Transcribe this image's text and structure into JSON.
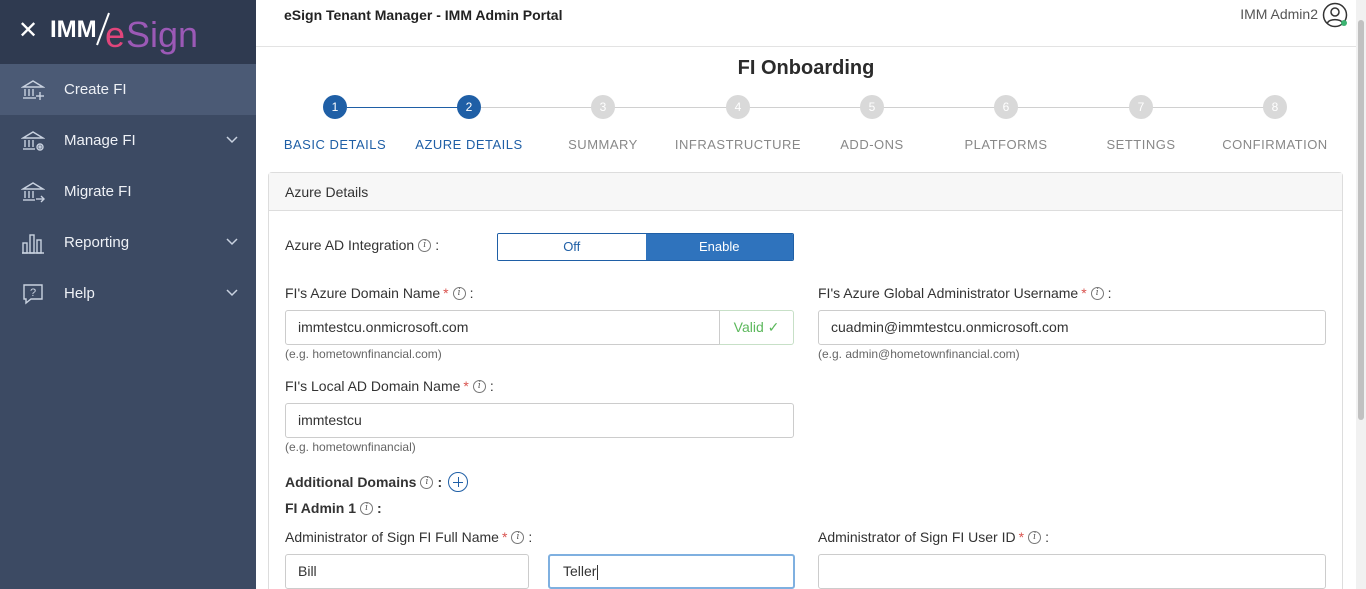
{
  "sidebar": {
    "logo_text": "IMM eSign",
    "items": [
      {
        "label": "Create FI",
        "icon": "bank-add-icon",
        "active": true,
        "expandable": false
      },
      {
        "label": "Manage FI",
        "icon": "bank-gear-icon",
        "active": false,
        "expandable": true
      },
      {
        "label": "Migrate FI",
        "icon": "bank-arrow-icon",
        "active": false,
        "expandable": false
      },
      {
        "label": "Reporting",
        "icon": "bar-chart-icon",
        "active": false,
        "expandable": true
      },
      {
        "label": "Help",
        "icon": "help-icon",
        "active": false,
        "expandable": true
      }
    ]
  },
  "header": {
    "title": "eSign Tenant Manager - IMM Admin Portal",
    "user": "IMM Admin2"
  },
  "page": {
    "title": "FI Onboarding"
  },
  "stepper": {
    "current_step": 2,
    "steps": [
      {
        "num": "1",
        "label": "BASIC DETAILS"
      },
      {
        "num": "2",
        "label": "AZURE DETAILS"
      },
      {
        "num": "3",
        "label": "SUMMARY"
      },
      {
        "num": "4",
        "label": "INFRASTRUCTURE"
      },
      {
        "num": "5",
        "label": "ADD-ONS"
      },
      {
        "num": "6",
        "label": "PLATFORMS"
      },
      {
        "num": "7",
        "label": "SETTINGS"
      },
      {
        "num": "8",
        "label": "CONFIRMATION"
      }
    ]
  },
  "form": {
    "section_title": "Azure Details",
    "azure_ad": {
      "label": "Azure AD Integration",
      "off": "Off",
      "on": "Enable",
      "selected": "Enable"
    },
    "domain_name": {
      "label": "FI's Azure Domain Name",
      "value": "immtestcu.onmicrosoft.com",
      "valid_text": "Valid",
      "hint": "(e.g. hometownfinancial.com)"
    },
    "global_admin": {
      "label": "FI's Azure Global Administrator Username",
      "value": "cuadmin@immtestcu.onmicrosoft.com",
      "hint": "(e.g. admin@hometownfinancial.com)"
    },
    "local_ad": {
      "label": "FI's Local AD Domain Name",
      "value": "immtestcu",
      "hint": "(e.g. hometownfinancial)"
    },
    "additional_domains": {
      "label": "Additional Domains"
    },
    "fi_admin": {
      "label": "FI Admin 1"
    },
    "admin_full_name": {
      "label": "Administrator of Sign FI Full Name",
      "first": "Bill",
      "last": "Teller"
    },
    "admin_user_id": {
      "label": "Administrator of Sign FI User ID",
      "value": ""
    }
  },
  "colors": {
    "sidebar": "#3c4a63",
    "accent": "#1f5fa6",
    "valid": "#5cb85c",
    "required": "#d9534f"
  }
}
